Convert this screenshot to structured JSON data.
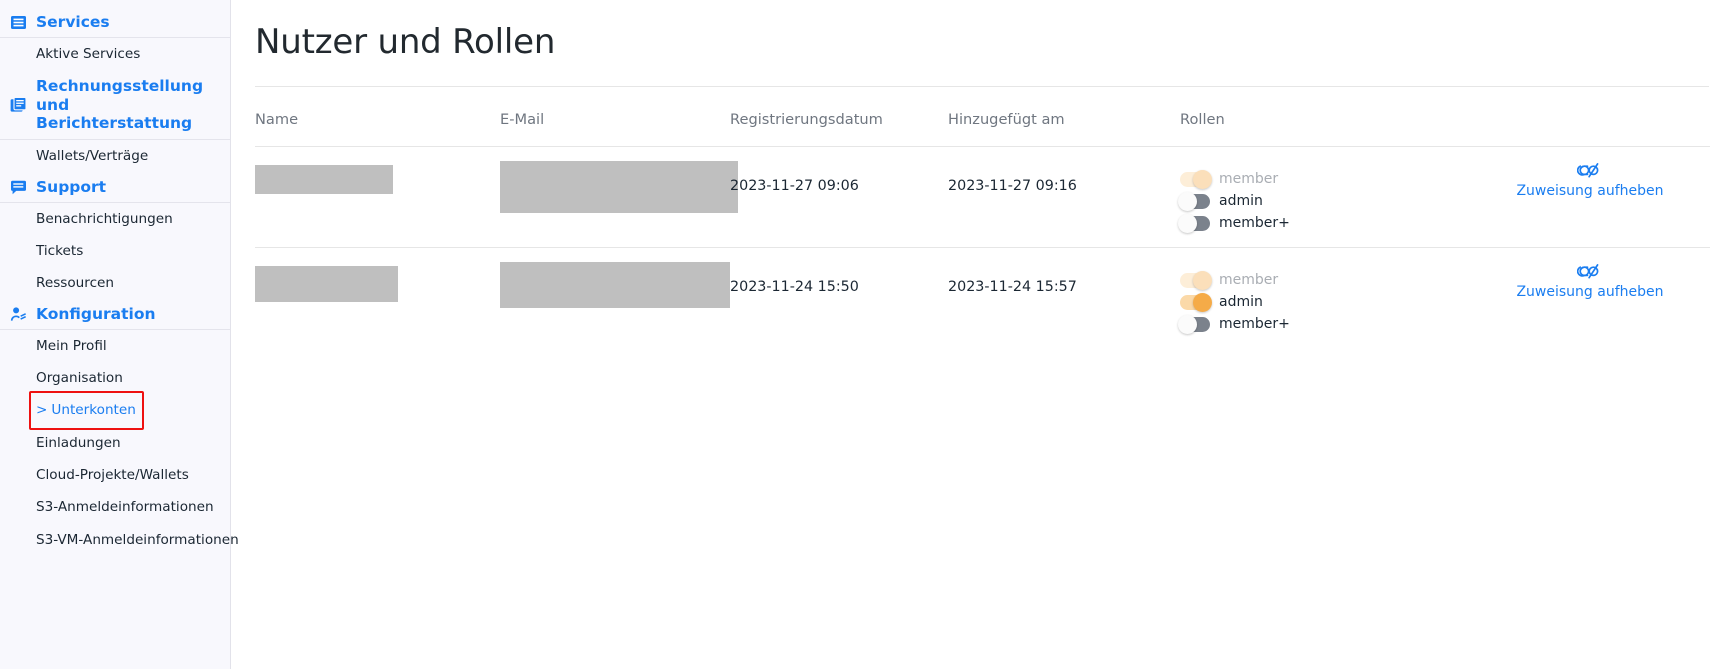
{
  "sidebar": {
    "sections": [
      {
        "label": "Services",
        "icon": "list-box-icon",
        "items": [
          {
            "label": "Aktive Services"
          }
        ]
      },
      {
        "label": "Rechnungsstellung und Berichterstattung",
        "icon": "documents-icon",
        "items": [
          {
            "label": "Wallets/Verträge"
          }
        ]
      },
      {
        "label": "Support",
        "icon": "chat-box-icon",
        "items": [
          {
            "label": "Benachrichtigungen"
          },
          {
            "label": "Tickets"
          },
          {
            "label": "Ressourcen"
          }
        ]
      },
      {
        "label": "Konfiguration",
        "icon": "user-settings-icon",
        "items": [
          {
            "label": "Mein Profil"
          },
          {
            "label": "Organisation"
          },
          {
            "label": "Unterkonten",
            "active": true,
            "chevron": ">"
          },
          {
            "label": "Einladungen"
          },
          {
            "label": "Cloud-Projekte/Wallets"
          },
          {
            "label": "S3-Anmeldeinformationen"
          },
          {
            "label": "S3-VM-Anmeldeinformationen"
          }
        ]
      }
    ],
    "highlight_color": "#ee1111",
    "accent_color": "#1a7df0"
  },
  "main": {
    "title": "Nutzer und Rollen",
    "table": {
      "columns": [
        "Name",
        "E-Mail",
        "Registrierungsdatum",
        "Hinzugefügt am",
        "Rollen",
        ""
      ],
      "rows": [
        {
          "name_redacted": true,
          "email_redacted": true,
          "registration_date": "2023-11-27 09:06",
          "added_date": "2023-11-27 09:16",
          "roles": [
            {
              "label": "member",
              "state": "on-disabled"
            },
            {
              "label": "admin",
              "state": "off"
            },
            {
              "label": "member+",
              "state": "off"
            }
          ],
          "action": {
            "label": "Zuweisung aufheben",
            "icon": "unlink-icon"
          }
        },
        {
          "name_redacted": true,
          "email_redacted": true,
          "registration_date": "2023-11-24 15:50",
          "added_date": "2023-11-24 15:57",
          "roles": [
            {
              "label": "member",
              "state": "on-disabled"
            },
            {
              "label": "admin",
              "state": "on"
            },
            {
              "label": "member+",
              "state": "off"
            }
          ],
          "action": {
            "label": "Zuweisung aufheben",
            "icon": "unlink-icon"
          }
        }
      ]
    }
  },
  "colors": {
    "accent": "#1a7df0",
    "toggle_on": "#f5ab48",
    "toggle_on_track": "#fbd9a8",
    "toggle_off": "#7b828c",
    "redact": "#bfbfbf",
    "sidebar_bg": "#f8f8fd",
    "highlight": "#ee1111"
  }
}
